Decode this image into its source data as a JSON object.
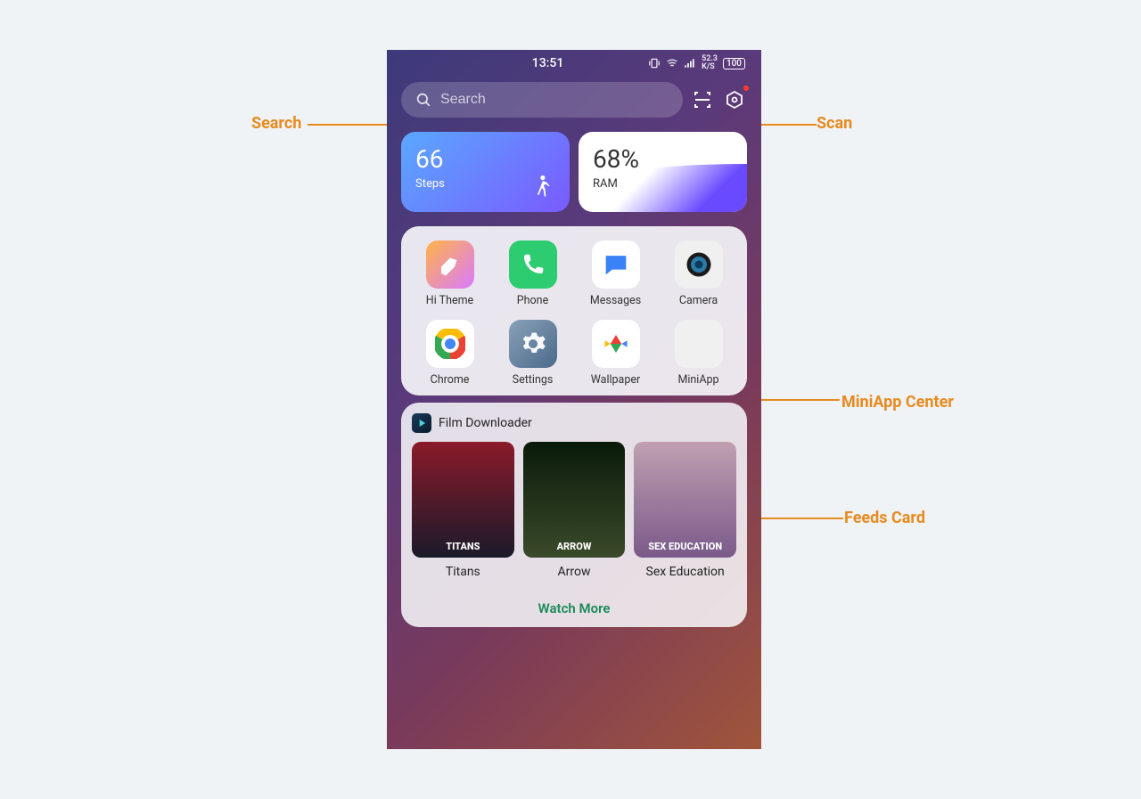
{
  "status": {
    "time": "13:51",
    "speed": "52.3",
    "speed_unit": "K/S",
    "battery": "100"
  },
  "search": {
    "placeholder": "Search"
  },
  "widgets": {
    "steps_value": "66",
    "steps_label": "Steps",
    "ram_value": "68%",
    "ram_label": "RAM"
  },
  "apps": [
    {
      "label": "Hi Theme",
      "icon": "theme"
    },
    {
      "label": "Phone",
      "icon": "phone"
    },
    {
      "label": "Messages",
      "icon": "msg"
    },
    {
      "label": "Camera",
      "icon": "cam"
    },
    {
      "label": "Chrome",
      "icon": "chrome"
    },
    {
      "label": "Settings",
      "icon": "settings"
    },
    {
      "label": "Wallpaper",
      "icon": "wall"
    },
    {
      "label": "MiniApp",
      "icon": "mini"
    }
  ],
  "feeds": {
    "title": "Film Downloader",
    "watch_more": "Watch More",
    "movies": [
      {
        "title": "Titans"
      },
      {
        "title": "Arrow"
      },
      {
        "title": "Sex Education"
      }
    ]
  },
  "annotations": {
    "search": "Search",
    "scan": "Scan",
    "miniapp": "MiniApp Center",
    "feeds": "Feeds Card"
  }
}
